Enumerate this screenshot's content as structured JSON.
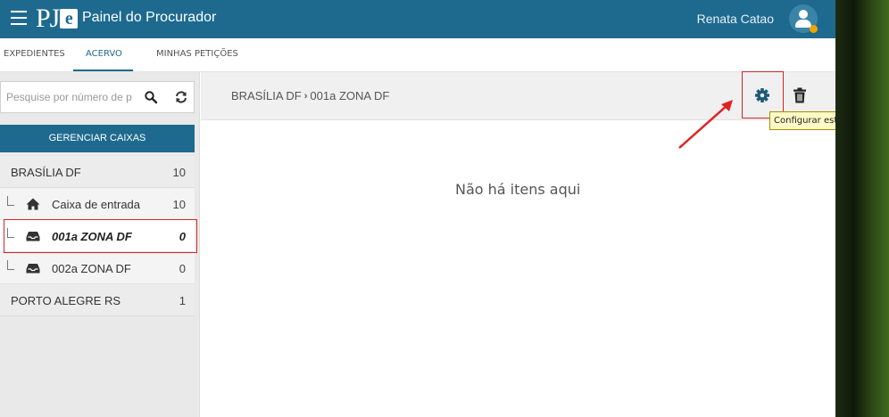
{
  "header": {
    "logo_text": "PJ",
    "logo_letter": "e",
    "title": "Painel do Procurador",
    "user_name": "Renata Catao"
  },
  "tabs": [
    {
      "label": "EXPEDIENTES"
    },
    {
      "label": "ACERVO",
      "active": true
    },
    {
      "label": "MINHAS PETIÇÕES"
    }
  ],
  "sidebar": {
    "search_placeholder": "Pesquise por número de p",
    "manage_label": "GERENCIAR CAIXAS",
    "groups": [
      {
        "label": "BRASÍLIA DF",
        "count": "10",
        "boxes": [
          {
            "label": "Caixa de entrada",
            "count": "10",
            "icon": "home-icon"
          },
          {
            "label": "001a ZONA DF",
            "count": "0",
            "icon": "inbox-icon",
            "active": true
          },
          {
            "label": "002a ZONA DF",
            "count": "0",
            "icon": "inbox-icon"
          }
        ]
      },
      {
        "label": "PORTO ALEGRE RS",
        "count": "1"
      }
    ]
  },
  "main": {
    "breadcrumb": [
      "BRASÍLIA DF",
      "001a ZONA DF"
    ],
    "breadcrumb_separator": "›",
    "empty_message": "Não há itens aqui",
    "tooltip": "Configurar esta caixa"
  },
  "colors": {
    "primary": "#1e6a8f",
    "highlight": "#d0262c",
    "avatar_status": "#f0a400"
  }
}
